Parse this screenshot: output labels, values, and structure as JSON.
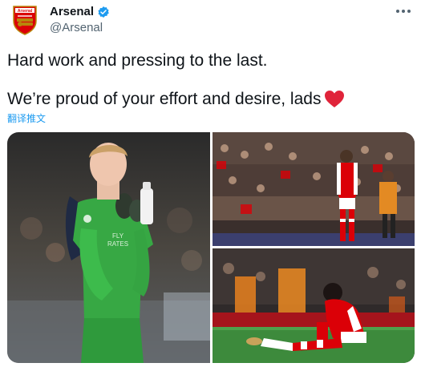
{
  "account": {
    "name": "Arsenal",
    "handle": "@Arsenal",
    "logo_text": "Arsenal"
  },
  "tweet": {
    "line1": "Hard work and pressing to the last.",
    "line2": "We’re proud of your effort and desire, lads",
    "translate_label": "翻译推文"
  },
  "media": {
    "shirt_text": "FLY\nRATES"
  },
  "icons": {
    "verified": "verified-badge-icon",
    "more": "more-options-icon",
    "heart": "red-heart-emoji-icon"
  },
  "colors": {
    "text": "#0f1419",
    "secondary": "#536471",
    "link": "#1d9bf0",
    "heart": "#e0243a",
    "arsenal_red": "#db0007",
    "keeper_green": "#37a844"
  }
}
